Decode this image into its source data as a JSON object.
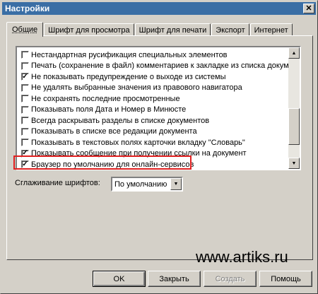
{
  "window": {
    "title": "Настройки"
  },
  "tabs": [
    "Общие",
    "Шрифт для просмотра",
    "Шрифт для печати",
    "Экспорт",
    "Интернет"
  ],
  "options": [
    {
      "label": "Нестандартная русификация специальных элементов",
      "checked": false
    },
    {
      "label": "Печать (сохранение в файл) комментариев к закладке из списка докумен",
      "checked": false
    },
    {
      "label": "Не показывать предупреждение о выходе из системы",
      "checked": true
    },
    {
      "label": "Не удалять выбранные значения из правового навигатора",
      "checked": false
    },
    {
      "label": "Не сохранять последние просмотренные",
      "checked": false
    },
    {
      "label": "Показывать поля Дата и Номер в Минюсте",
      "checked": false
    },
    {
      "label": "Всегда раскрывать разделы в списке документов",
      "checked": false
    },
    {
      "label": "Показывать в списке все редакции документа",
      "checked": false
    },
    {
      "label": "Показывать в текстовых полях карточки вкладку \"Словарь\"",
      "checked": false
    },
    {
      "label": "Показывать сообщение при получении ссылки на документ",
      "checked": true
    },
    {
      "label": "Браузер по умолчанию для онлайн-сервисов",
      "checked": true
    }
  ],
  "smoothing": {
    "label": "Сглаживание шрифтов:",
    "value": "По умолчанию"
  },
  "watermark": "www.artiks.ru",
  "buttons": {
    "ok": "OK",
    "close": "Закрыть",
    "save": "Создать",
    "help": "Помощь"
  },
  "highlight_color": "#e02020"
}
